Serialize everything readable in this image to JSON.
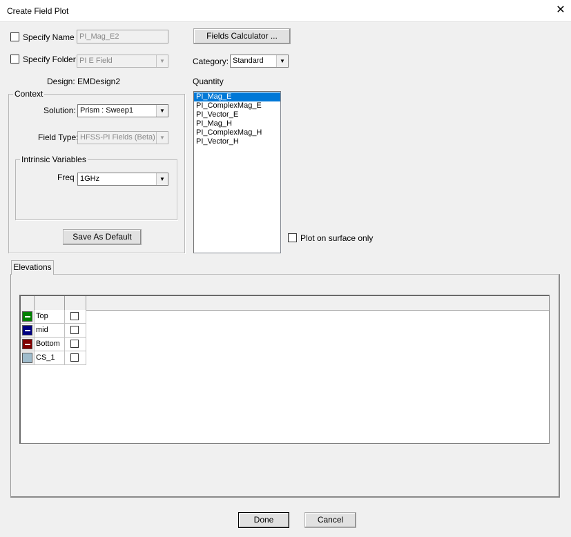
{
  "window": {
    "title": "Create Field Plot",
    "close_label": "✕"
  },
  "name": {
    "checkbox_label": "Specify Name",
    "value": "PI_Mag_E2",
    "checked": false
  },
  "folder": {
    "checkbox_label": "Specify Folder",
    "value": "PI E Field",
    "checked": false
  },
  "fields_calculator_label": "Fields Calculator ...",
  "category": {
    "label": "Category:",
    "value": "Standard"
  },
  "design": {
    "label": "Design:",
    "value": "EMDesign2"
  },
  "quantity": {
    "label": "Quantity",
    "items": [
      "PI_Mag_E",
      "PI_ComplexMag_E",
      "PI_Vector_E",
      "PI_Mag_H",
      "PI_ComplexMag_H",
      "PI_Vector_H"
    ],
    "selected_index": 0
  },
  "context": {
    "caption": "Context",
    "solution": {
      "label": "Solution:",
      "value": "Prism : Sweep1"
    },
    "field_type": {
      "label": "Field Type:",
      "value": "HFSS-PI Fields (Beta)"
    },
    "intrinsic": {
      "caption": "Intrinsic Variables",
      "freq_label": "Freq",
      "freq_value": "1GHz"
    },
    "save_default_label": "Save As Default"
  },
  "plot_surface": {
    "label": "Plot on surface only",
    "checked": false
  },
  "elevations": {
    "tab_label": "Elevations",
    "rows": [
      {
        "name": "Top",
        "color": "#008000",
        "dash": true,
        "checked": false
      },
      {
        "name": "mid",
        "color": "#00007f",
        "dash": true,
        "checked": false
      },
      {
        "name": "Bottom",
        "color": "#800000",
        "dash": true,
        "checked": false
      },
      {
        "name": "CS_1",
        "color": "#9fbccc",
        "dash": false,
        "checked": false
      }
    ]
  },
  "buttons": {
    "done": "Done",
    "cancel": "Cancel"
  }
}
